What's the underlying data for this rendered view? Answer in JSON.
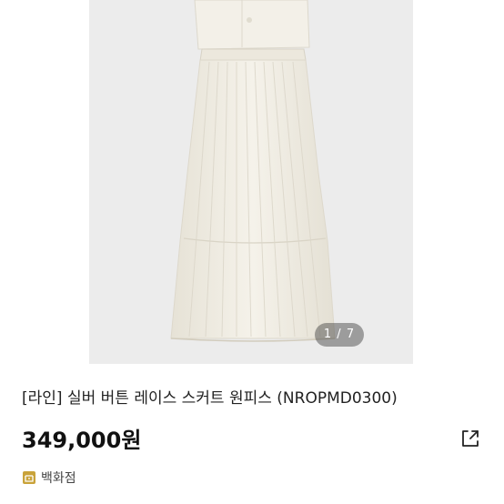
{
  "gallery": {
    "image": "pleated-lace-skirt-photo",
    "indicator": "1 / 7"
  },
  "product": {
    "title": "[라인] 실버 버튼 레이스 스커트 원피스 (NROPMD0300)",
    "price": "349,000원"
  },
  "seller": {
    "type_label": "백화점",
    "icon": "store-icon"
  },
  "actions": {
    "share_icon": "share-icon"
  },
  "colors": {
    "gallery_bg": "#ececec",
    "skirt": "#f2efe6",
    "badge": "#c9a33a"
  }
}
